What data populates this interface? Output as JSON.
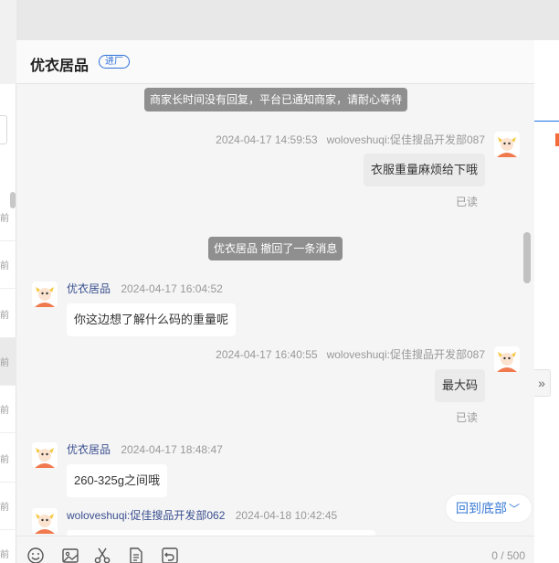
{
  "header": {
    "shop_name": "优衣居品",
    "badge": "进厂"
  },
  "sidebar": {
    "items": [
      {
        "time": "前"
      },
      {
        "time": "前"
      },
      {
        "time": "前"
      },
      {
        "time": "前"
      },
      {
        "time": "前"
      },
      {
        "time": "前"
      },
      {
        "time": "前"
      },
      {
        "time": "前"
      }
    ]
  },
  "messages": {
    "notice1": "商家长时间没有回复，平台已通知商家，请耐心等待",
    "m1": {
      "time": "2024-04-17 14:59:53",
      "sender": "woloveshuqi:促佳搜品开发部087",
      "text": "衣服重量麻烦给下哦",
      "read": "已读"
    },
    "notice2": "优衣居品 撤回了一条消息",
    "m2": {
      "sender": "优衣居品",
      "time": "2024-04-17 16:04:52",
      "text": "你这边想了解什么码的重量呢"
    },
    "m3": {
      "time": "2024-04-17 16:40:55",
      "sender": "woloveshuqi:促佳搜品开发部087",
      "text": "最大码",
      "read": "已读"
    },
    "m4": {
      "sender": "优衣居品",
      "time": "2024-04-17 18:48:47",
      "text": "260-325g之间哦"
    },
    "m5": {
      "sender": "woloveshuqi:促佳搜品开发部062",
      "time": "2024-04-18 10:42:45"
    }
  },
  "to_bottom": "回到底部",
  "toolbar": {
    "icons": [
      "emoji-icon",
      "image-icon",
      "scissors-icon",
      "document-icon",
      "recall-icon"
    ],
    "counter": "0 / 500"
  },
  "colors": {
    "accent": "#2e6fd8",
    "notice": "#8f8f8f",
    "avatar": "#f07a4e"
  }
}
